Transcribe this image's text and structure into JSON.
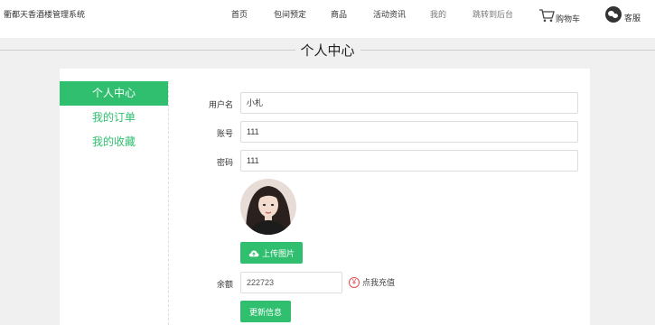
{
  "header": {
    "brand": "衢都天香酒楼管理系统",
    "nav": [
      "首页",
      "包间预定",
      "商品",
      "活动资讯",
      "我的",
      "跳转到后台"
    ],
    "cart_label": "购物车",
    "service_label": "客服"
  },
  "page": {
    "title": "个人中心"
  },
  "sidebar": {
    "items": [
      {
        "label": "个人中心",
        "active": true
      },
      {
        "label": "我的订单",
        "active": false
      },
      {
        "label": "我的收藏",
        "active": false
      }
    ]
  },
  "form": {
    "username_label": "用户名",
    "username_value": "小札",
    "account_label": "账号",
    "account_value": "111",
    "password_label": "密码",
    "password_value": "111",
    "upload_button": "上传图片",
    "balance_label": "余额",
    "balance_value": "222723",
    "recharge_icon": "¥",
    "recharge_label": "点我充值",
    "update_button": "更新信息"
  },
  "colors": {
    "accent": "#2fbf6f",
    "recharge": "#e05050"
  }
}
